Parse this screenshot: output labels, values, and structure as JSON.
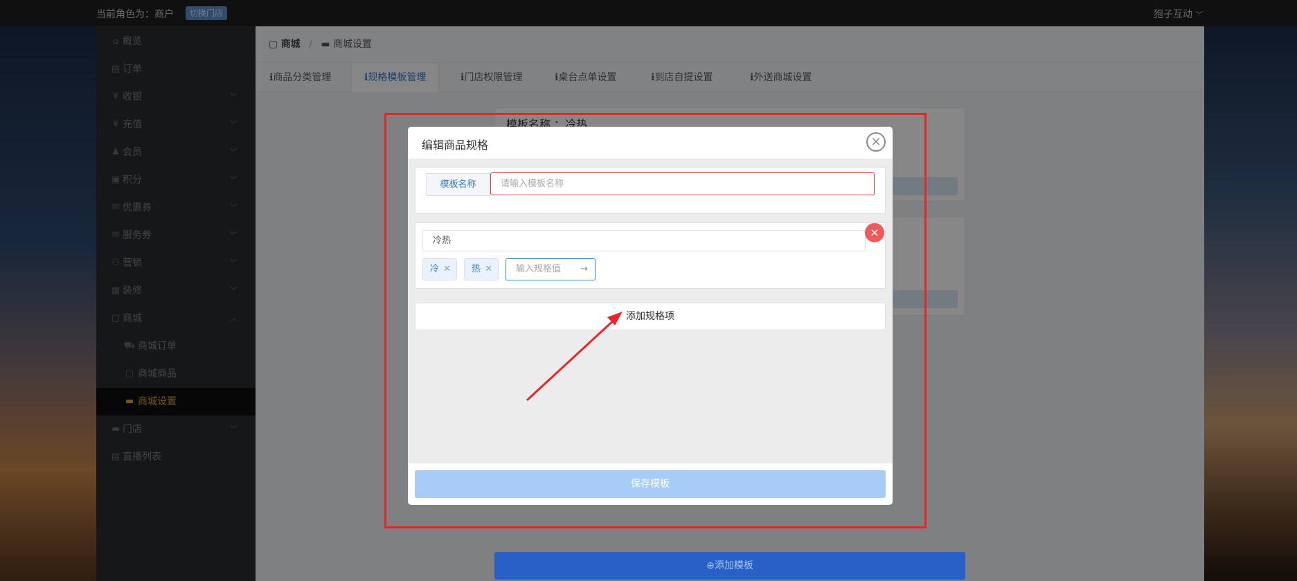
{
  "topbar": {
    "role_text": "当前角色为：商户",
    "switch_store": "切换门店",
    "user_name": "狍子互动"
  },
  "sidebar": {
    "items": [
      {
        "label": "概览"
      },
      {
        "label": "订单"
      },
      {
        "label": "收银"
      },
      {
        "label": "充值"
      },
      {
        "label": "会员"
      },
      {
        "label": "积分"
      },
      {
        "label": "优惠券"
      },
      {
        "label": "服务券"
      },
      {
        "label": "营销"
      },
      {
        "label": "装修"
      },
      {
        "label": "商城"
      },
      {
        "label": "商城订单"
      },
      {
        "label": "商城商品"
      },
      {
        "label": "商城设置"
      },
      {
        "label": "门店"
      },
      {
        "label": "直播列表"
      }
    ]
  },
  "breadcrumb": {
    "root": "商城",
    "separator": "/",
    "current": "商城设置"
  },
  "tabs": [
    {
      "label": "商品分类管理"
    },
    {
      "label": "规格模板管理"
    },
    {
      "label": "门店权限管理"
    },
    {
      "label": "桌台点单设置"
    },
    {
      "label": "到店自提设置"
    },
    {
      "label": "外送商城设置"
    }
  ],
  "background_card": {
    "title": "模板名称 ：冷热"
  },
  "add_template_label": "添加模板",
  "modal": {
    "title": "编辑商品规格",
    "name_label": "模板名称",
    "name_placeholder": "请输入模板名称",
    "spec_name": "冷热",
    "spec_values": [
      {
        "label": "冷"
      },
      {
        "label": "热"
      }
    ],
    "value_placeholder": "输入规格值",
    "add_spec_label": "添加规格项",
    "save_label": "保存模板"
  },
  "colors": {
    "accent": "#3b7bd4",
    "active_nav": "#d9a527",
    "annotation_red": "#e6262a",
    "save_button": "#a6cdf5"
  }
}
